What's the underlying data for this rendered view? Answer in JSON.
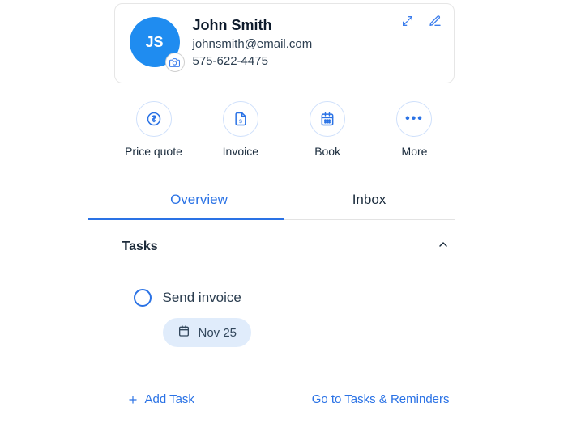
{
  "contact": {
    "initials": "JS",
    "name": "John Smith",
    "email": "johnsmith@email.com",
    "phone": "575-622-4475"
  },
  "actions": {
    "price_quote": "Price quote",
    "invoice": "Invoice",
    "book": "Book",
    "more": "More"
  },
  "tabs": {
    "overview": "Overview",
    "inbox": "Inbox"
  },
  "tasks": {
    "heading": "Tasks",
    "items": [
      {
        "title": "Send invoice",
        "date": "Nov 25"
      }
    ],
    "add_label": "Add Task",
    "goto_label": "Go to Tasks & Reminders"
  }
}
